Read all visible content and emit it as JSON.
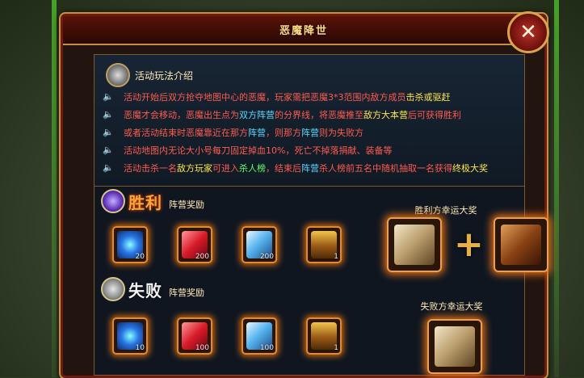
{
  "window": {
    "title": "恶魔降世",
    "close_label": "✕"
  },
  "rules": {
    "title": "活动玩法介绍",
    "lines": [
      [
        {
          "t": "活动开始后双方抢夺地图中心的恶魔，玩家需把恶魔3*3范围内敌方成员",
          "c": "#ff5b4f"
        },
        {
          "t": "击杀或驱赶",
          "c": "#ffe64a"
        }
      ],
      [
        {
          "t": "恶魔才会移动，恶魔出生点为",
          "c": "#ff5b4f"
        },
        {
          "t": "双方阵营",
          "c": "#5bd6ff"
        },
        {
          "t": "的分界线，将恶魔推至",
          "c": "#ff5b4f"
        },
        {
          "t": "敌方大本营",
          "c": "#ffe64a"
        },
        {
          "t": "后可获得胜利",
          "c": "#ff5b4f"
        }
      ],
      [
        {
          "t": "或者活动结束时恶魔靠近在那方",
          "c": "#ff5b4f"
        },
        {
          "t": "阵营",
          "c": "#5bd6ff"
        },
        {
          "t": "，则那方",
          "c": "#ff5b4f"
        },
        {
          "t": "阵营",
          "c": "#5bd6ff"
        },
        {
          "t": "则为失败方",
          "c": "#ff5b4f"
        }
      ],
      [
        {
          "t": "活动地图内无论大小号每刀固定掉血10%，死亡不掉落捐献、装备等",
          "c": "#ff5b4f"
        }
      ],
      [
        {
          "t": "活动击杀一名",
          "c": "#ff5b4f"
        },
        {
          "t": "敌方玩家",
          "c": "#ffe64a"
        },
        {
          "t": "可进入",
          "c": "#ff5b4f"
        },
        {
          "t": "杀人榜",
          "c": "#5bff6a"
        },
        {
          "t": "，结束后",
          "c": "#ff5b4f"
        },
        {
          "t": "阵营",
          "c": "#5bd6ff"
        },
        {
          "t": "杀人榜前五名中随机抽取一名获得",
          "c": "#ff5b4f"
        },
        {
          "t": "终极大奖",
          "c": "#ffe64a"
        }
      ]
    ]
  },
  "win": {
    "title": "胜利",
    "camp_reward": "阵营奖励",
    "lucky_label": "胜利方幸运大奖",
    "items": [
      {
        "icon": "blue-orb-icon",
        "count": "20"
      },
      {
        "icon": "red-crystal-icon",
        "count": "200"
      },
      {
        "icon": "crystal-icon",
        "count": "200"
      },
      {
        "icon": "treasure-chest-icon",
        "count": "1"
      }
    ],
    "plus": "+"
  },
  "lose": {
    "title": "失败",
    "camp_reward": "阵营奖励",
    "lucky_label": "失败方幸运大奖",
    "items": [
      {
        "icon": "blue-orb-icon",
        "count": "10"
      },
      {
        "icon": "red-crystal-icon",
        "count": "100"
      },
      {
        "icon": "crystal-icon",
        "count": "100"
      },
      {
        "icon": "treasure-chest-icon",
        "count": "1"
      }
    ]
  }
}
